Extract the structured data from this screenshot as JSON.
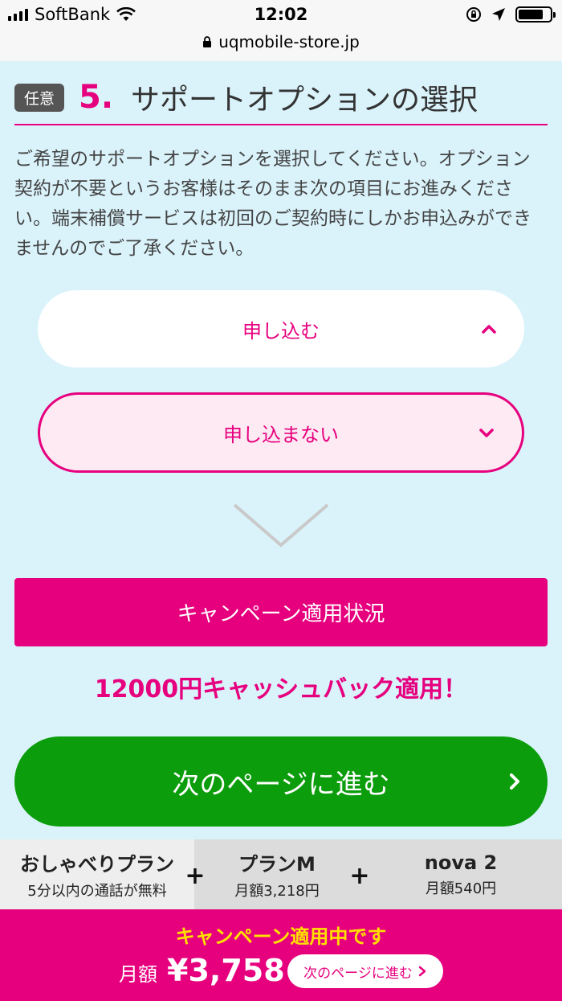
{
  "status_bar": {
    "carrier": "SoftBank",
    "time": "12:02",
    "url": "uqmobile-store.jp"
  },
  "section": {
    "badge": "任意",
    "step_number": "5.",
    "title": "サポートオプションの選択"
  },
  "description": "ご希望のサポートオプションを選択してください。オプション契約が不要というお客様はそのまま次の項目にお進みください。端末補償サービスは初回のご契約時にしかお申込みができませんのでご了承ください。",
  "options": {
    "apply_label": "申し込む",
    "no_apply_label": "申し込まない",
    "selected": "申し込まない"
  },
  "campaign": {
    "button_label": "キャンペーン適用状況",
    "cashback_text": "12000円キャッシュバック適用！"
  },
  "next_button": {
    "label": "次のページに進む"
  },
  "plan_bar": {
    "items": [
      {
        "name": "おしゃべりプラン",
        "sub": "5分以内の通話が無料"
      },
      {
        "name": "プランM",
        "sub": "月額3,218円"
      },
      {
        "name": "nova 2",
        "sub": "月額540円"
      }
    ],
    "plus": "+"
  },
  "footer": {
    "title": "キャンペーン適用中です",
    "price_label": "月額",
    "price_value": "¥3,758",
    "button_label": "次のページに進む"
  },
  "colors": {
    "accent": "#e6007e",
    "next": "#0c9d0c",
    "background": "#daf3fb",
    "highlight": "#ffe000"
  }
}
